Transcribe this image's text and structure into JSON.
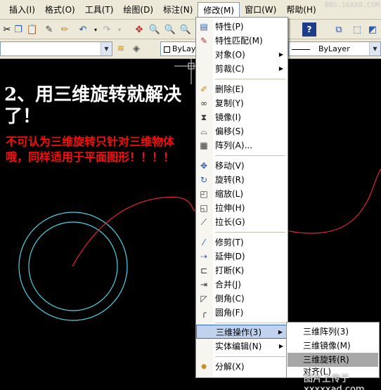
{
  "menubar": {
    "items": [
      "插入(I)",
      "格式(O)",
      "工具(T)",
      "绘图(D)",
      "标注(N)",
      "修改(M)",
      "窗口(W)",
      "帮助(H)"
    ],
    "watermark": "BBS.16XX8.COM"
  },
  "layerbar": {
    "layer_combo": "ByLayer",
    "linetype_combo": "ByLayer",
    "lineweight_combo": "ByLayer"
  },
  "drawing": {
    "headline": "2、用三维旋转就解决了！",
    "note": "不可认为三维旋转只针对三维物体哦，同样适用于平面图形！！！！",
    "colors": {
      "circle": "#4dd4e6",
      "curve": "#e0243a",
      "note": "#ff0a0a"
    }
  },
  "modify_menu": {
    "items": [
      {
        "label": "特性(P)",
        "icon": "properties-icon"
      },
      {
        "label": "特性匹配(M)",
        "icon": "match-properties-icon"
      },
      {
        "label": "对象(O)",
        "submenu": true
      },
      {
        "label": "剪裁(C)",
        "submenu": true
      },
      {
        "label": "删除(E)",
        "icon": "erase-icon"
      },
      {
        "label": "复制(Y)",
        "icon": "copy-icon"
      },
      {
        "label": "镜像(I)",
        "icon": "mirror-icon"
      },
      {
        "label": "偏移(S)",
        "icon": "offset-icon"
      },
      {
        "label": "阵列(A)...",
        "icon": "array-icon"
      },
      {
        "label": "移动(V)",
        "icon": "move-icon"
      },
      {
        "label": "旋转(R)",
        "icon": "rotate-icon"
      },
      {
        "label": "缩放(L)",
        "icon": "scale-icon"
      },
      {
        "label": "拉伸(H)",
        "icon": "stretch-icon"
      },
      {
        "label": "拉长(G)",
        "icon": "lengthen-icon"
      },
      {
        "label": "修剪(T)",
        "icon": "trim-icon"
      },
      {
        "label": "延伸(D)",
        "icon": "extend-icon"
      },
      {
        "label": "打断(K)",
        "icon": "break-icon"
      },
      {
        "label": "合并(J)",
        "icon": "join-icon"
      },
      {
        "label": "倒角(C)",
        "icon": "chamfer-icon"
      },
      {
        "label": "圆角(F)",
        "icon": "fillet-icon"
      },
      {
        "label": "三维操作(3)",
        "submenu": true
      },
      {
        "label": "实体编辑(N)",
        "submenu": true
      },
      {
        "label": "分解(X)",
        "icon": "explode-icon"
      }
    ]
  },
  "submenu_3d": {
    "items": [
      "三维阵列(3)",
      "三维镜像(M)",
      "三维旋转(R)",
      "对齐(L)"
    ]
  },
  "watermark2": "图片上传于 xxxxxad.com"
}
